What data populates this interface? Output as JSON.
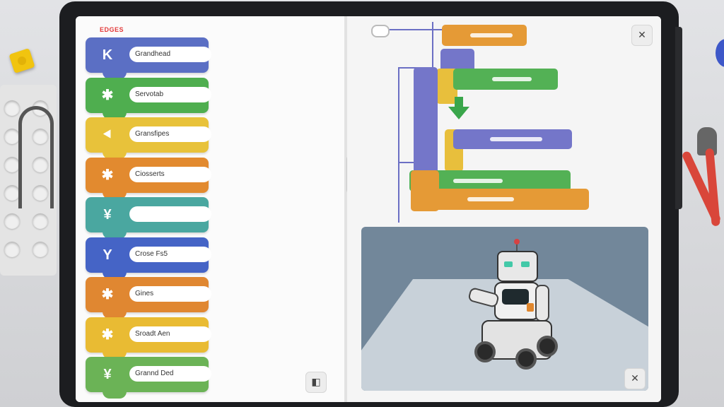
{
  "palette": {
    "tag": "EDGES",
    "blocks": [
      {
        "label": "Grandhead",
        "color": "#5b6fc4",
        "icon": "K"
      },
      {
        "label": "Servotab",
        "color": "#4fae4f",
        "icon": "✱"
      },
      {
        "label": "Gransfipes",
        "color": "#e8c23a",
        "icon": "⯇"
      },
      {
        "label": "Ciosserts",
        "color": "#e28a2f",
        "icon": "✱"
      },
      {
        "label": "",
        "color": "#4aa7a0",
        "icon": "¥"
      },
      {
        "label": "Crose Fs5",
        "color": "#4564c6",
        "icon": "Y"
      },
      {
        "label": "Gines",
        "color": "#e08731",
        "icon": "✱"
      },
      {
        "label": "Sroadt Aen",
        "color": "#e9bb33",
        "icon": "✱"
      },
      {
        "label": "Grannd Ded",
        "color": "#6bb356",
        "icon": "¥"
      }
    ]
  },
  "code": {
    "colors": {
      "purple": "#7476c9",
      "orange": "#e59a36",
      "green": "#53b155",
      "yellow": "#e8bf3c",
      "arrow": "#3aa64b"
    }
  },
  "viewport": {
    "floor_color": "#c8d1d9",
    "sky_color": "#72879a"
  },
  "icons": {
    "close_top": "✕",
    "close_viewport": "✕",
    "panel_toggle": "◧"
  }
}
